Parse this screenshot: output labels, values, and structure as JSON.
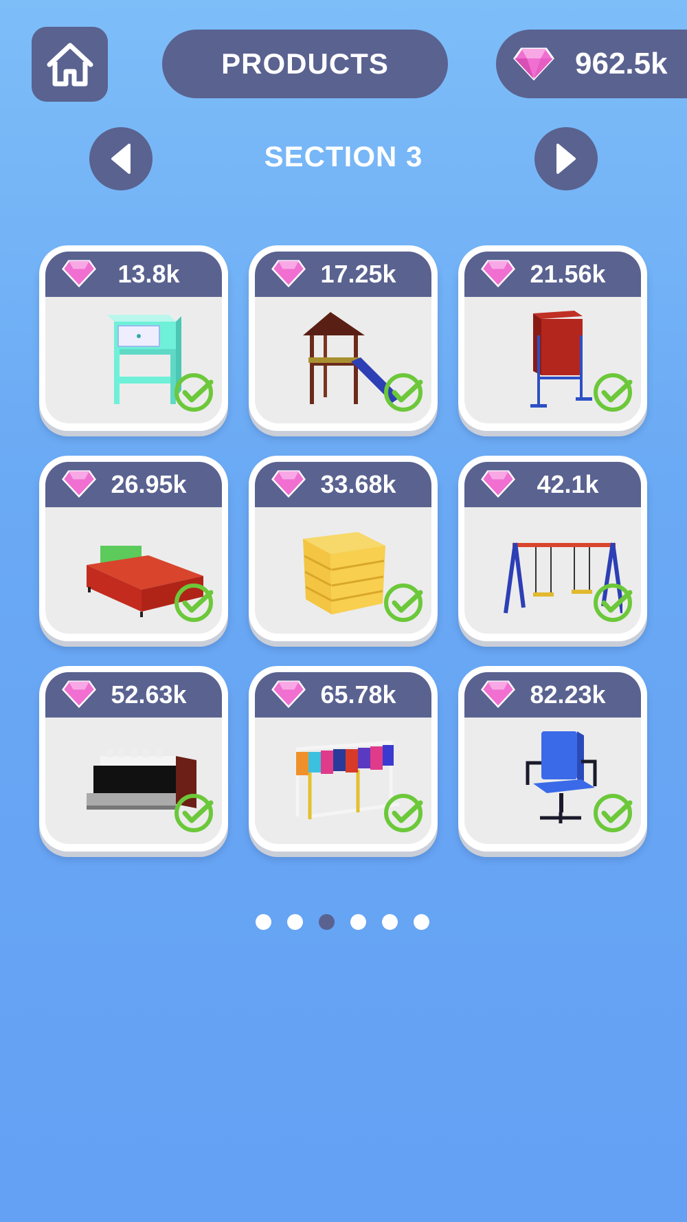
{
  "header": {
    "title": "PRODUCTS",
    "gems": "962.5k"
  },
  "section": {
    "title": "SECTION 3"
  },
  "products": [
    {
      "price": "13.8k",
      "item": "nightstand",
      "owned": true
    },
    {
      "price": "17.25k",
      "item": "playground-slide",
      "owned": true
    },
    {
      "price": "21.56k",
      "item": "red-board-stand",
      "owned": true
    },
    {
      "price": "26.95k",
      "item": "red-bed",
      "owned": true
    },
    {
      "price": "33.68k",
      "item": "wooden-crate",
      "owned": true
    },
    {
      "price": "42.1k",
      "item": "swing-set",
      "owned": true
    },
    {
      "price": "52.63k",
      "item": "piano",
      "owned": true
    },
    {
      "price": "65.78k",
      "item": "clothes-rack",
      "owned": true
    },
    {
      "price": "82.23k",
      "item": "office-chair",
      "owned": true
    }
  ],
  "pagination": {
    "pages": 6,
    "current": 3
  },
  "colors": {
    "panel": "#5a6290",
    "gem": "#f06fd0",
    "check": "#6cc83a"
  }
}
